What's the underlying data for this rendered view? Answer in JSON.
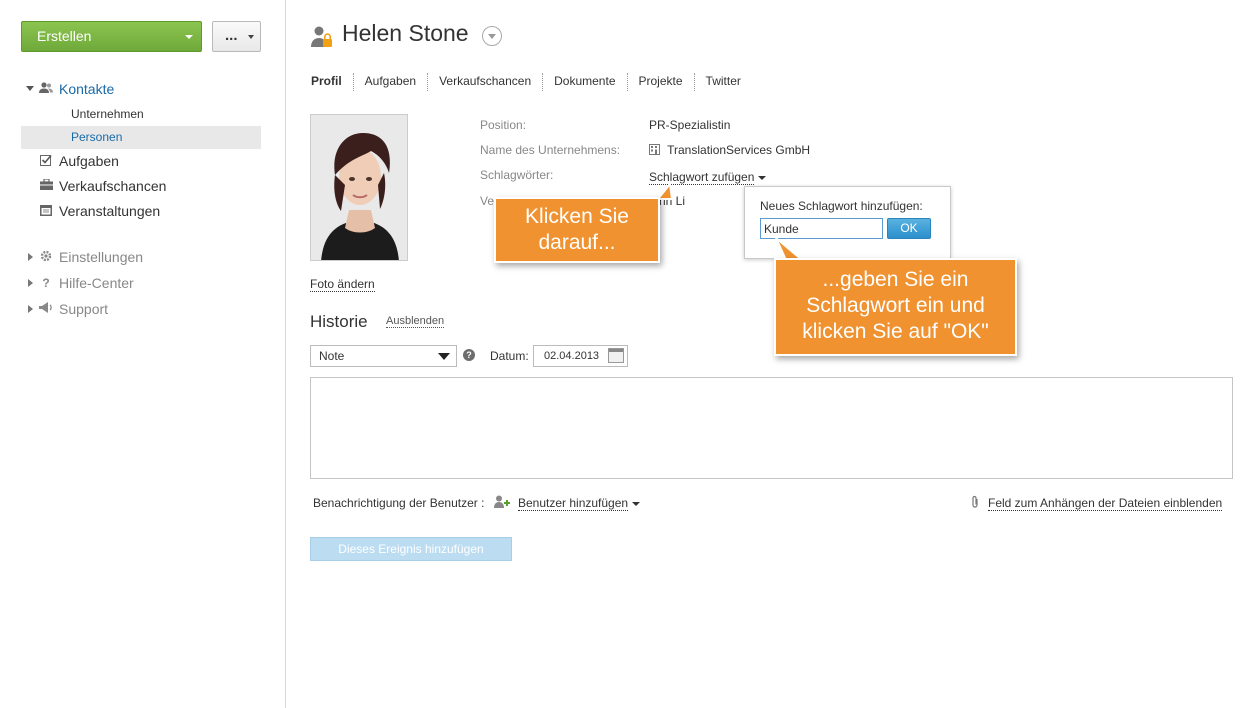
{
  "sidebar": {
    "create_label": "Erstellen",
    "more_label": "...",
    "contacts_label": "Kontakte",
    "sub_companies": "Unternehmen",
    "sub_persons": "Personen",
    "tasks_label": "Aufgaben",
    "opportunities_label": "Verkaufschancen",
    "events_label": "Veranstaltungen",
    "settings_label": "Einstellungen",
    "help_label": "Hilfe-Center",
    "support_label": "Support"
  },
  "header": {
    "title": "Helen Stone"
  },
  "tabs": [
    "Profil",
    "Aufgaben",
    "Verkaufschancen",
    "Dokumente",
    "Projekte",
    "Twitter"
  ],
  "profile": {
    "change_photo": "Foto ändern",
    "position_label": "Position:",
    "position_value": "PR-Spezialistin",
    "company_label": "Name des Unternehmens:",
    "company_value": "TranslationServices GmbH",
    "tags_label": "Schlagwörter:",
    "tags_link": "Schlagwort zufügen",
    "fourth_label_partial": "Ve",
    "fourth_value_partial": "rin Li"
  },
  "tag_popup": {
    "label": "Neues Schlagwort hinzufügen:",
    "input_value": "Kunde",
    "ok_label": "OK"
  },
  "callouts": {
    "first": "Klicken Sie darauf...",
    "second": "...geben Sie ein Schlagwort ein und klicken Sie auf \"OK\""
  },
  "history": {
    "title": "Historie",
    "hide_label": "Ausblenden",
    "type_value": "Note",
    "date_label": "Datum:",
    "date_value": "02.04.2013",
    "notify_label": "Benachrichtigung der Benutzer :",
    "add_users_label": "Benutzer hinzufügen",
    "attach_label": "Feld zum Anhängen der Dateien einblenden",
    "add_event_label": "Dieses Ereignis hinzufügen"
  },
  "colors": {
    "create_button": "#7cb843",
    "active_nav_text": "#1a6aa8",
    "callout": "#f0922f",
    "ok_button": "#2b8fcc",
    "add_event_button": "#bcdcf1"
  }
}
